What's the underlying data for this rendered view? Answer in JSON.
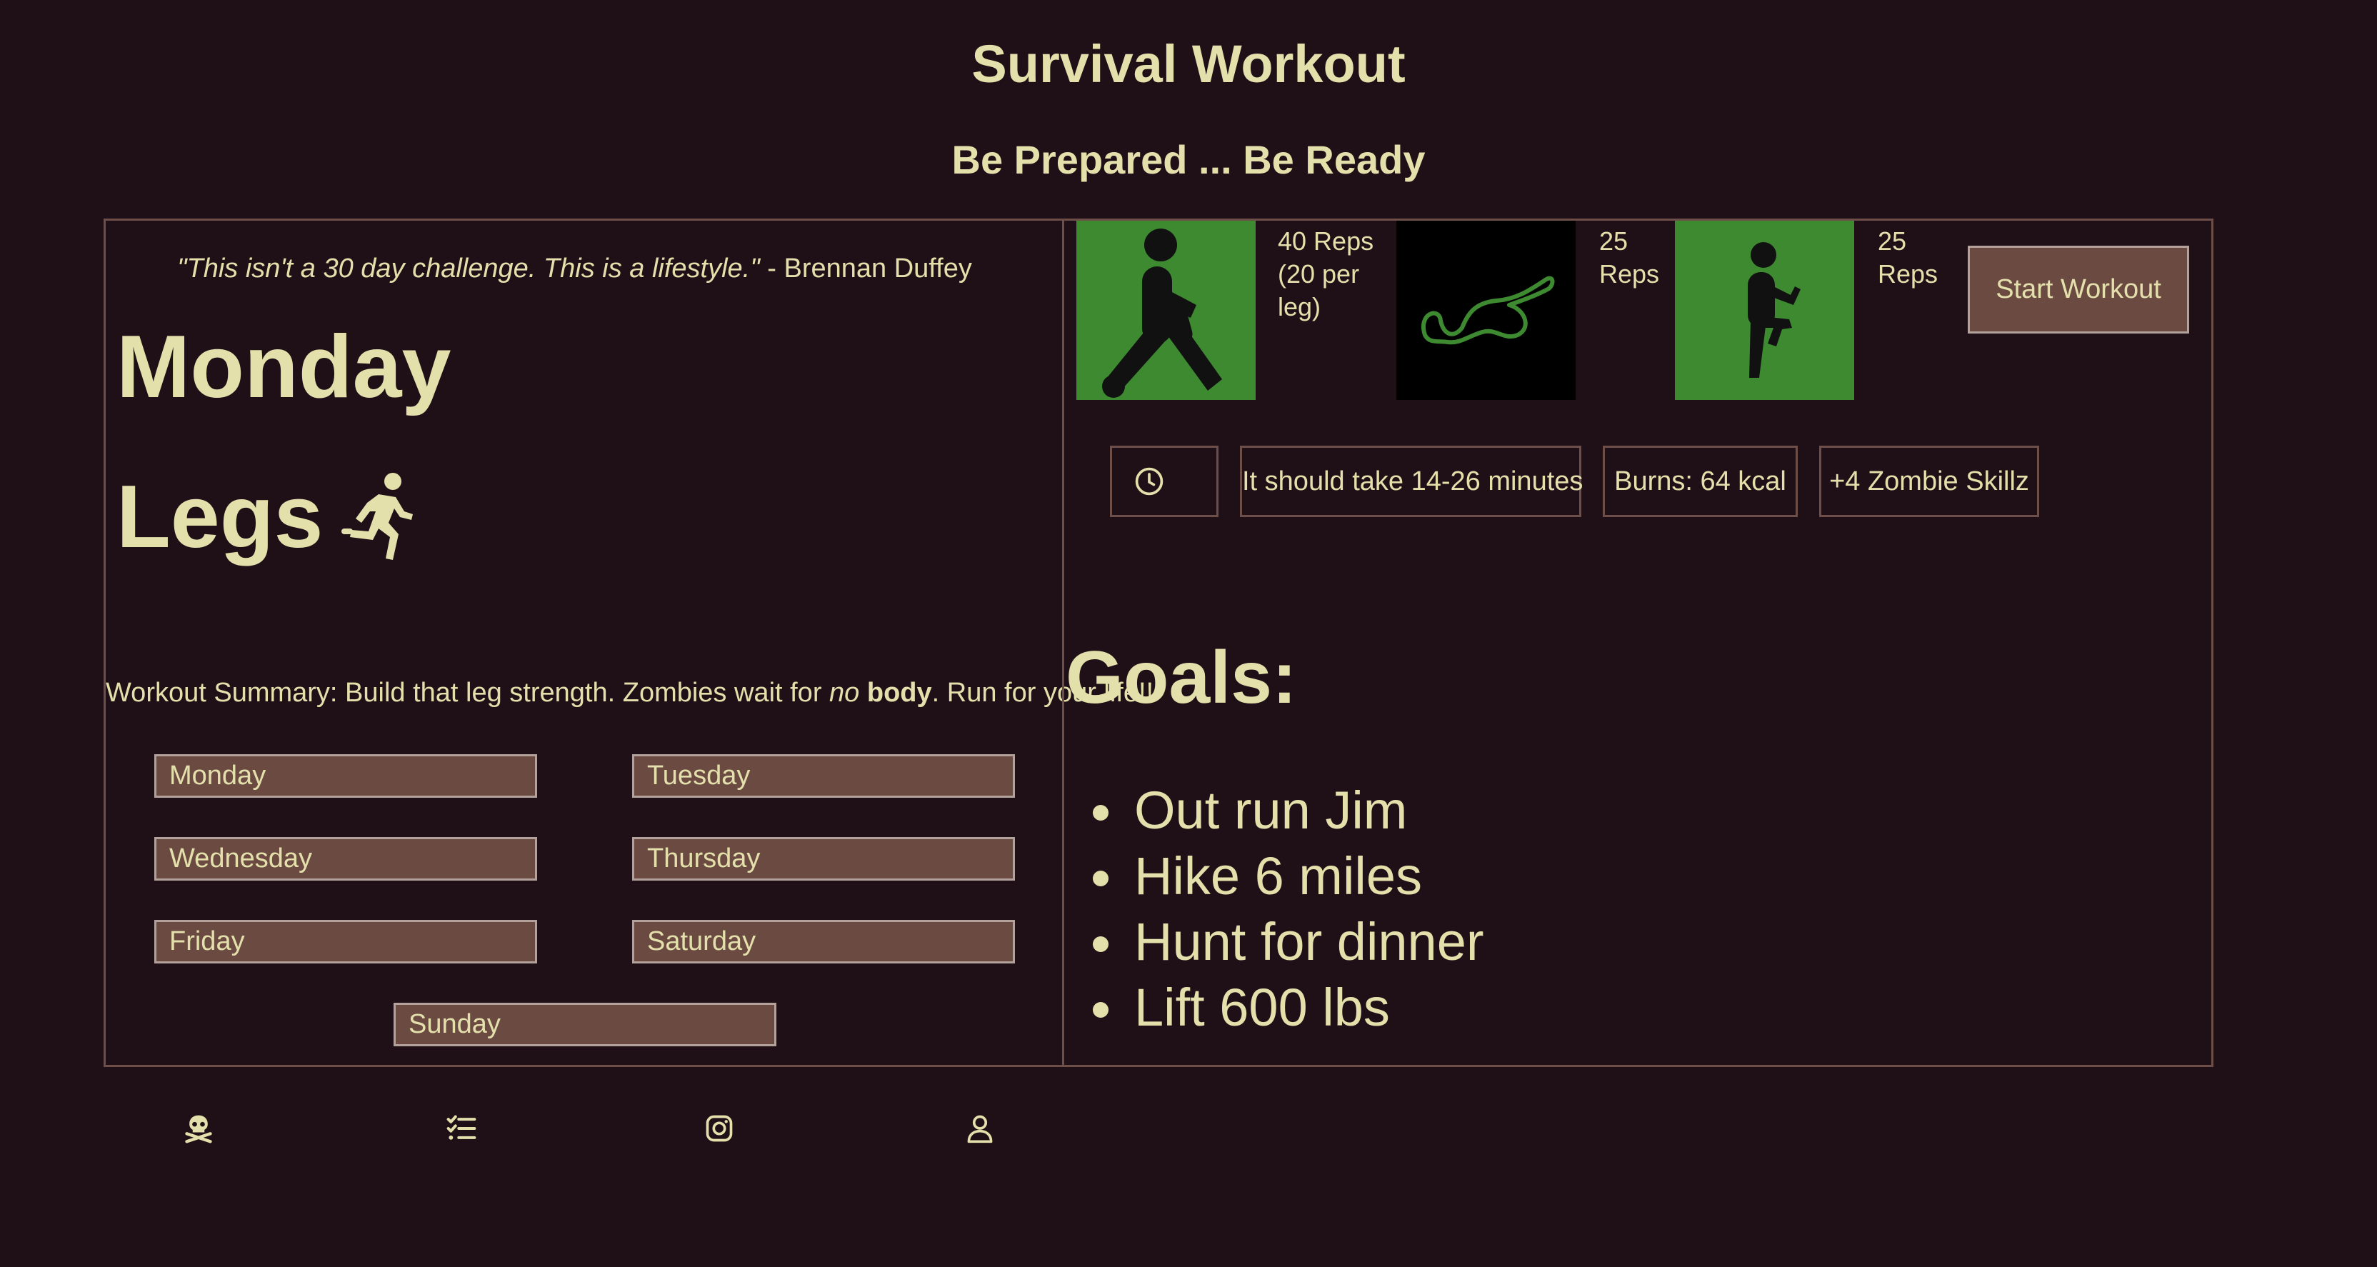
{
  "header": {
    "title": "Survival Workout",
    "subtitle": "Be Prepared ... Be Ready"
  },
  "day_panel": {
    "quote_text": "\"This isn't a 30 day challenge. This is a lifestyle.\"",
    "quote_author": " - Brennan Duffey",
    "day": "Monday",
    "focus": "Legs",
    "focus_icon": "running-person-icon",
    "summary": {
      "part1": "Workout Summary: Build that leg strength. Zombies wait for ",
      "em": "no",
      "part2": " ",
      "strong": "body",
      "part3": ". Run for your life!!"
    },
    "days": {
      "monday": "Monday",
      "tuesday": "Tuesday",
      "wednesday": "Wednesday",
      "thursday": "Thursday",
      "friday": "Friday",
      "saturday": "Saturday",
      "sunday": "Sunday"
    }
  },
  "exercises": [
    {
      "icon": "lunge-figure-icon",
      "reps_lines": [
        "40 Reps",
        "(20 per",
        "leg)"
      ]
    },
    {
      "icon": "glute-bridge-figure-icon",
      "reps_lines": [
        "25",
        "Reps"
      ]
    },
    {
      "icon": "high-knee-figure-icon",
      "reps_lines": [
        "25",
        "Reps"
      ]
    }
  ],
  "actions": {
    "start_workout": "Start Workout"
  },
  "stats": {
    "clock_icon": "clock-icon",
    "duration": "It should take 14-26 minutes",
    "burns": "Burns: 64 kcal",
    "skill": "+4 Zombie Skillz"
  },
  "goals": {
    "heading": "Goals:",
    "items": [
      "Out run Jim",
      "Hike 6 miles",
      "Hunt for dinner",
      "Lift 600 lbs"
    ]
  },
  "footer": {
    "icons": [
      "skull-crossbones-icon",
      "checklist-icon",
      "instagram-icon",
      "user-icon"
    ]
  },
  "colors": {
    "background": "#1f1017",
    "text": "#e4e0ac",
    "button": "#6b4a42",
    "exercise_green": "#3d8a31",
    "exercise_black": "#000000"
  }
}
